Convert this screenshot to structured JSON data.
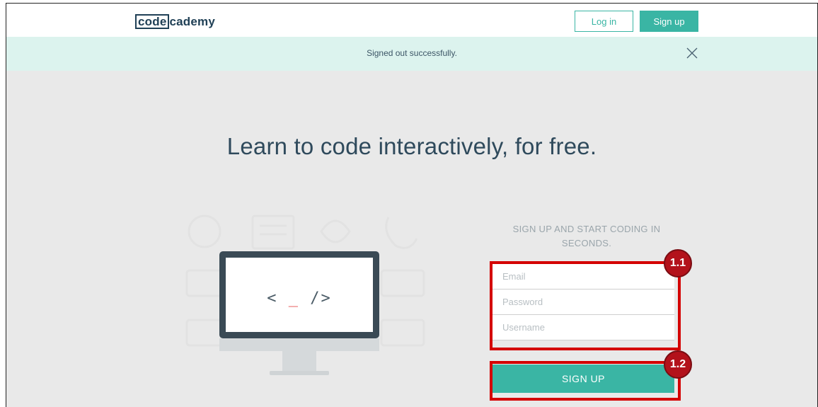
{
  "header": {
    "logo_part1": "code",
    "logo_part2": "cademy",
    "login_label": "Log in",
    "signup_label": "Sign up"
  },
  "notice": {
    "message": "Signed out successfully.",
    "close_icon": "close-icon"
  },
  "hero": {
    "headline": "Learn to code interactively, for free.",
    "code_prefix": "<",
    "code_cursor": "_",
    "code_suffix": "/>"
  },
  "signup_form": {
    "heading": "SIGN UP AND START CODING IN SECONDS.",
    "email_placeholder": "Email",
    "password_placeholder": "Password",
    "username_placeholder": "Username",
    "submit_label": "SIGN UP"
  },
  "annotations": {
    "fields_badge": "1.1",
    "button_badge": "1.2"
  },
  "colors": {
    "accent": "#3ab5a4",
    "notice_bg": "#dcf3ee",
    "annotation_red": "#d40000",
    "page_bg": "#e9e9e9"
  }
}
